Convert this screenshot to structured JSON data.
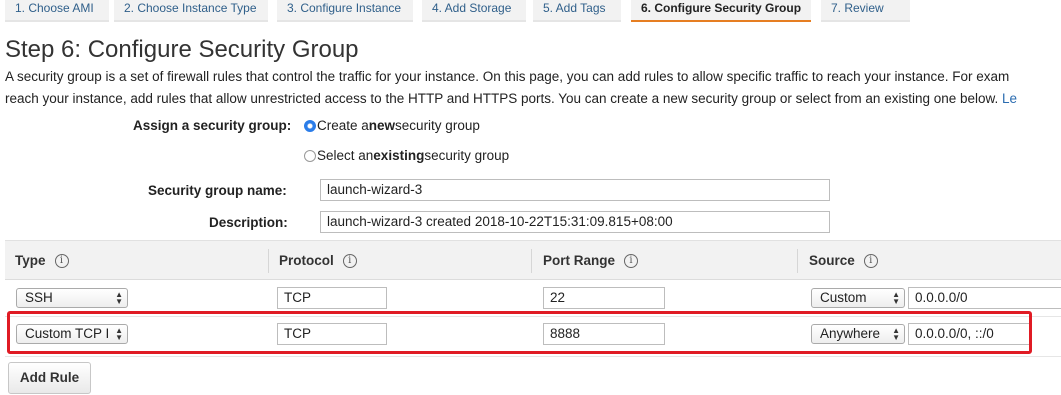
{
  "tabs": [
    {
      "label": "1. Choose AMI"
    },
    {
      "label": "2. Choose Instance Type"
    },
    {
      "label": "3. Configure Instance"
    },
    {
      "label": "4. Add Storage"
    },
    {
      "label": "5. Add Tags"
    },
    {
      "label": "6. Configure Security Group",
      "active": true
    },
    {
      "label": "7. Review"
    }
  ],
  "page": {
    "title": "Step 6: Configure Security Group",
    "intro_line1": "A security group is a set of firewall rules that control the traffic for your instance. On this page, you can add rules to allow specific traffic to reach your instance. For exam",
    "intro_line2": "reach your instance, add rules that allow unrestricted access to the HTTP and HTTPS ports. You can create a new security group or select from an existing one below.",
    "intro_link": "Le"
  },
  "assign": {
    "label": "Assign a security group:",
    "option_new_pre": "Create a ",
    "option_new_bold": "new",
    "option_new_post": " security group",
    "option_existing_pre": "Select an ",
    "option_existing_bold": "existing",
    "option_existing_post": " security group",
    "selected": "new"
  },
  "security_group": {
    "name_label": "Security group name:",
    "name_value": "launch-wizard-3",
    "description_label": "Description:",
    "description_value": "launch-wizard-3 created 2018-10-22T15:31:09.815+08:00"
  },
  "rules": {
    "headers": [
      "Type",
      "Protocol",
      "Port Range",
      "Source"
    ],
    "info_glyph": "i",
    "rows": [
      {
        "type": "SSH",
        "protocol": "TCP",
        "port": "22",
        "source_type": "Custom",
        "source_value": "0.0.0.0/0"
      },
      {
        "type": "Custom TCP I",
        "protocol": "TCP",
        "port": "8888",
        "source_type": "Anywhere",
        "source_value": "0.0.0.0/0, ::/0"
      }
    ],
    "highlighted_row": 1,
    "highlight_color": "#e01b24"
  },
  "buttons": {
    "add_rule": "Add Rule"
  },
  "colors": {
    "active_tab_underline": "#e67e22",
    "radio_selected": "#2b7de9",
    "link": "#2b6cb0"
  }
}
